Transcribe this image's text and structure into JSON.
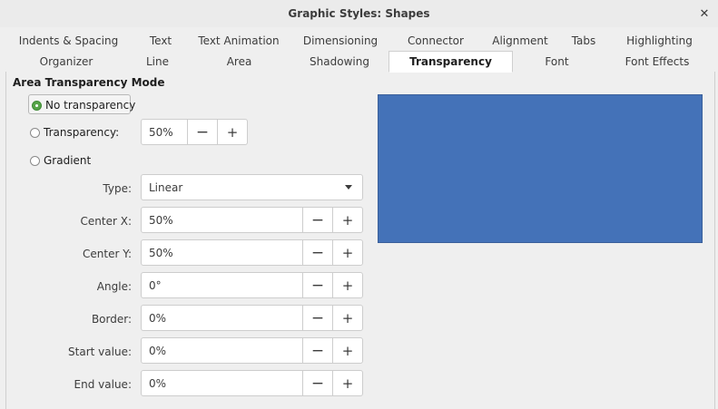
{
  "window": {
    "title": "Graphic Styles: Shapes"
  },
  "tabs_row1": [
    {
      "label": "Indents & Spacing"
    },
    {
      "label": "Text"
    },
    {
      "label": "Text Animation"
    },
    {
      "label": "Dimensioning"
    },
    {
      "label": "Connector"
    },
    {
      "label": "Alignment"
    },
    {
      "label": "Tabs"
    },
    {
      "label": "Highlighting"
    }
  ],
  "tabs_row2": [
    {
      "label": "Organizer"
    },
    {
      "label": "Line"
    },
    {
      "label": "Area"
    },
    {
      "label": "Shadowing"
    },
    {
      "label": "Transparency",
      "active": true
    },
    {
      "label": "Font"
    },
    {
      "label": "Font Effects"
    }
  ],
  "section": {
    "title": "Area Transparency Mode"
  },
  "modes": {
    "no_transparency": {
      "label": "No transparency",
      "checked": true
    },
    "transparency": {
      "label": "Transparency:",
      "checked": false,
      "value": "50%"
    },
    "gradient": {
      "label": "Gradient",
      "checked": false
    }
  },
  "gradient_fields": {
    "type": {
      "label": "Type:",
      "value": "Linear"
    },
    "center_x": {
      "label": "Center X:",
      "value": "50%"
    },
    "center_y": {
      "label": "Center Y:",
      "value": "50%"
    },
    "angle": {
      "label": "Angle:",
      "value": "0°"
    },
    "border": {
      "label": "Border:",
      "value": "0%"
    },
    "start_value": {
      "label": "Start value:",
      "value": "0%"
    },
    "end_value": {
      "label": "End value:",
      "value": "0%"
    }
  },
  "buttons": {
    "minus": "−",
    "plus": "+"
  },
  "preview": {
    "color": "#4472b8"
  }
}
